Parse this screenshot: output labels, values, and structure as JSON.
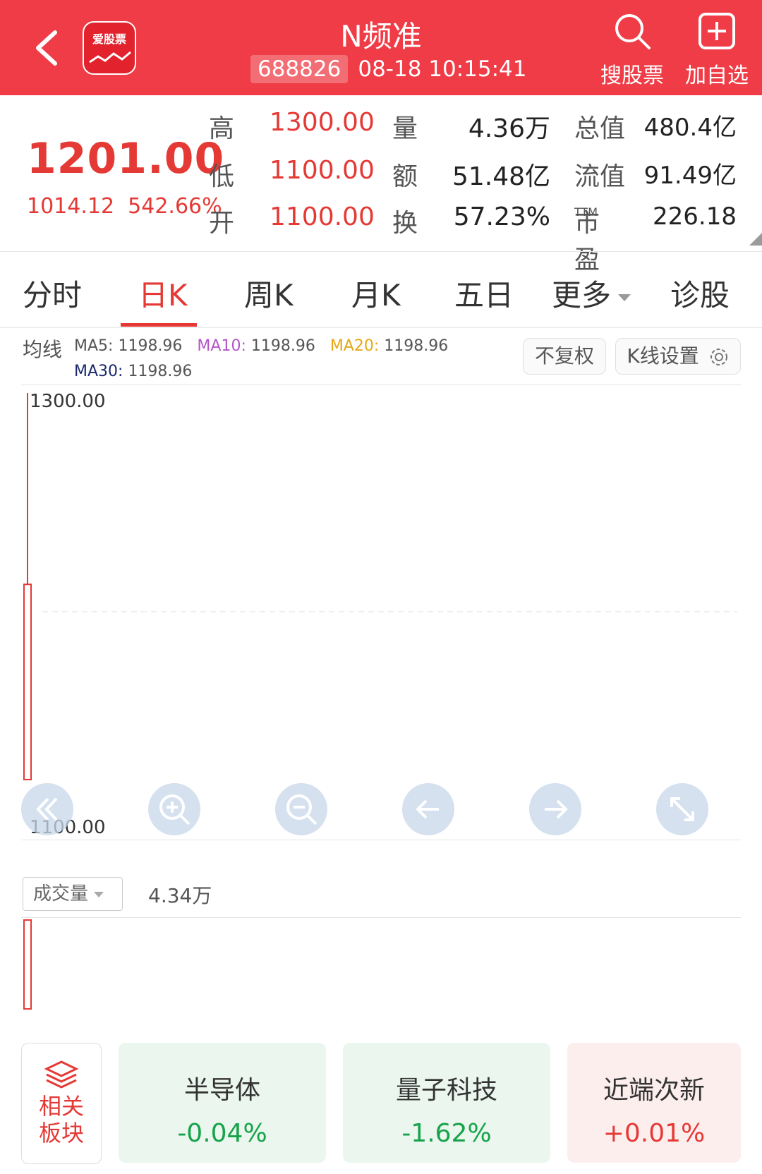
{
  "header": {
    "title": "N频准",
    "code": "688826",
    "datetime": "08-18 10:15:41",
    "logo_text": "爱股票",
    "search_label": "搜股票",
    "add_label": "加自选"
  },
  "quote": {
    "price": "1201.00",
    "change": "1014.12",
    "change_pct": "542.66%",
    "rows": [
      {
        "l1": "高",
        "v1": "1300.00",
        "l2": "量",
        "v2": "4.36万",
        "l3": "总值",
        "v3": "480.4亿"
      },
      {
        "l1": "低",
        "v1": "1100.00",
        "l2": "额",
        "v2": "51.48亿",
        "l3": "流值",
        "v3": "91.49亿"
      },
      {
        "l1": "开",
        "v1": "1100.00",
        "l2": "换",
        "v2": "57.23%",
        "l3": "市盈",
        "l3sup": "TTM",
        "v3": "226.18"
      }
    ]
  },
  "tabs": [
    "分时",
    "日K",
    "周K",
    "月K",
    "五日",
    "更多",
    "诊股"
  ],
  "active_tab": "日K",
  "ma": {
    "label": "均线",
    "ma5_label": "MA5:",
    "ma5": "1198.96",
    "ma10_label": "MA10:",
    "ma10": "1198.96",
    "ma20_label": "MA20:",
    "ma20": "1198.96",
    "ma30_label": "MA30:",
    "ma30": "1198.96",
    "colors": {
      "ma5": "#555555",
      "ma10": "#b455c9",
      "ma20": "#e6a817",
      "ma30": "#1a2a6c"
    }
  },
  "buttons": {
    "fuquan": "不复权",
    "kline_settings": "K线设置"
  },
  "chart_data": {
    "type": "candlestick",
    "y_max_label": "1300.00",
    "y_min_label": "1100.00",
    "ylim": [
      1100,
      1300
    ],
    "candles": [
      {
        "open": 1100.0,
        "high": 1300.0,
        "low": 1100.0,
        "close": 1201.0
      }
    ],
    "volume": {
      "label": "成交量",
      "value": "4.34万"
    }
  },
  "related": {
    "label1": "相关",
    "label2": "板块"
  },
  "sectors": [
    {
      "name": "半导体",
      "change": "-0.04%",
      "color": "#17a34a",
      "bg": "#eaf6ee"
    },
    {
      "name": "量子科技",
      "change": "-1.62%",
      "color": "#17a34a",
      "bg": "#eaf6ee"
    },
    {
      "name": "近端次新",
      "change": "+0.01%",
      "color": "#e53935",
      "bg": "#fdeeee"
    }
  ]
}
